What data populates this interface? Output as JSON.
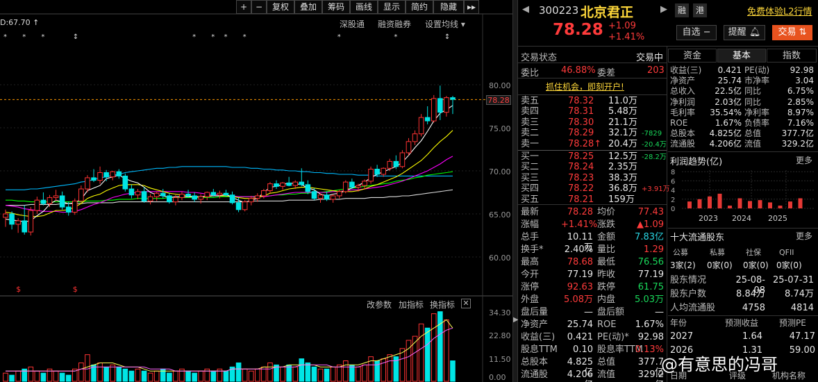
{
  "toolbar": {
    "items": [
      "+",
      "−",
      "复权",
      "叠加",
      "筹码",
      "画线",
      "显示",
      "简约",
      "隐藏"
    ],
    "ma_value": "D:67.70",
    "links": [
      "深股通",
      "融资融券",
      "设置均线"
    ]
  },
  "chart": {
    "price_axis": [
      "80.00",
      "75.00",
      "70.00",
      "65.00",
      "60.00"
    ],
    "last_price_tag": "78.28",
    "volume_axis": [
      "34.30",
      "22.80",
      "11.50",
      "0.00"
    ],
    "volume_links": [
      "改参数",
      "加指标",
      "换指标"
    ],
    "colors": {
      "up": "#ff3333",
      "down": "#00e5e5",
      "ma5": "#ffffff",
      "ma10": "#ffff00",
      "ma20": "#ff00ff",
      "ma60": "#00ff00",
      "ma120": "#00bbff",
      "ma250": "#dddddd"
    }
  },
  "chart_data": {
    "type": "candlestick",
    "ylim": [
      58,
      82
    ],
    "candles": [
      [
        64.6,
        65.5,
        63.5,
        65.0
      ],
      [
        65.0,
        65.3,
        63.2,
        63.8
      ],
      [
        63.8,
        64.5,
        62.8,
        64.2
      ],
      [
        64.2,
        66.0,
        62.6,
        62.9
      ],
      [
        62.9,
        65.8,
        62.5,
        65.4
      ],
      [
        65.4,
        67.0,
        65.0,
        66.6
      ],
      [
        66.6,
        67.5,
        66.0,
        66.2
      ],
      [
        66.2,
        67.2,
        65.8,
        66.9
      ],
      [
        66.9,
        67.8,
        66.5,
        67.1
      ],
      [
        67.1,
        67.6,
        65.5,
        65.8
      ],
      [
        65.8,
        66.4,
        64.8,
        65.2
      ],
      [
        65.2,
        66.8,
        64.9,
        66.5
      ],
      [
        66.5,
        68.3,
        66.3,
        67.9
      ],
      [
        67.9,
        69.5,
        67.5,
        69.2
      ],
      [
        69.2,
        70.2,
        68.7,
        68.9
      ],
      [
        68.9,
        70.5,
        68.5,
        69.8
      ],
      [
        69.8,
        70.1,
        68.8,
        69.3
      ],
      [
        69.3,
        70.0,
        68.9,
        69.9
      ],
      [
        69.9,
        70.2,
        69.1,
        69.4
      ],
      [
        69.4,
        69.7,
        67.6,
        67.9
      ],
      [
        67.9,
        68.4,
        66.8,
        67.2
      ],
      [
        67.2,
        67.9,
        66.7,
        67.6
      ],
      [
        67.6,
        68.1,
        66.3,
        66.5
      ],
      [
        66.5,
        67.3,
        66.1,
        67.0
      ],
      [
        67.0,
        67.6,
        66.5,
        67.4
      ],
      [
        67.4,
        67.9,
        66.8,
        67.1
      ],
      [
        67.1,
        67.4,
        66.2,
        66.4
      ],
      [
        66.4,
        67.2,
        66.0,
        66.9
      ],
      [
        66.9,
        67.6,
        66.6,
        67.3
      ],
      [
        67.3,
        67.8,
        66.9,
        67.1
      ],
      [
        67.1,
        67.5,
        66.4,
        66.7
      ],
      [
        66.7,
        67.3,
        66.2,
        67.0
      ],
      [
        67.0,
        67.6,
        66.6,
        67.5
      ],
      [
        67.5,
        67.9,
        67.0,
        67.2
      ],
      [
        67.2,
        67.7,
        66.8,
        67.4
      ],
      [
        67.4,
        67.8,
        67.0,
        67.2
      ],
      [
        67.2,
        67.6,
        66.1,
        66.3
      ],
      [
        66.3,
        66.9,
        65.2,
        65.5
      ],
      [
        65.5,
        66.6,
        65.3,
        66.4
      ],
      [
        66.4,
        67.1,
        66.0,
        66.8
      ],
      [
        66.8,
        67.4,
        66.4,
        67.1
      ],
      [
        67.1,
        67.9,
        66.8,
        67.7
      ],
      [
        67.7,
        68.7,
        67.4,
        68.5
      ],
      [
        68.5,
        68.9,
        67.9,
        68.2
      ],
      [
        68.2,
        68.7,
        67.8,
        68.6
      ],
      [
        68.6,
        69.3,
        68.2,
        68.3
      ],
      [
        68.3,
        68.9,
        67.9,
        68.7
      ],
      [
        68.7,
        70.3,
        68.2,
        68.4
      ],
      [
        68.4,
        68.9,
        67.3,
        67.6
      ],
      [
        67.6,
        68.0,
        66.6,
        66.8
      ],
      [
        66.8,
        67.4,
        66.3,
        67.2
      ],
      [
        67.2,
        67.6,
        66.5,
        66.7
      ],
      [
        66.7,
        67.3,
        66.3,
        67.1
      ],
      [
        67.1,
        67.8,
        66.8,
        67.6
      ],
      [
        67.6,
        68.9,
        67.4,
        68.7
      ],
      [
        68.7,
        69.1,
        67.9,
        68.1
      ],
      [
        68.1,
        68.5,
        67.6,
        68.3
      ],
      [
        68.3,
        69.0,
        67.9,
        68.8
      ],
      [
        68.8,
        70.5,
        68.5,
        70.2
      ],
      [
        70.2,
        70.7,
        69.3,
        69.6
      ],
      [
        69.6,
        70.4,
        69.3,
        70.3
      ],
      [
        70.3,
        71.4,
        70.0,
        71.1
      ],
      [
        71.1,
        71.8,
        70.2,
        70.5
      ],
      [
        70.5,
        72.4,
        70.3,
        72.1
      ],
      [
        72.1,
        73.8,
        71.8,
        73.4
      ],
      [
        73.4,
        74.7,
        73.0,
        74.3
      ],
      [
        74.3,
        76.6,
        74.0,
        76.2
      ],
      [
        76.2,
        77.5,
        75.4,
        75.8
      ],
      [
        75.8,
        78.8,
        75.6,
        78.4
      ],
      [
        78.4,
        79.9,
        75.9,
        76.8
      ],
      [
        76.8,
        78.7,
        76.3,
        78.5
      ],
      [
        78.5,
        78.7,
        76.6,
        78.3
      ]
    ],
    "volume": [
      4,
      3,
      5,
      6,
      7,
      5,
      4,
      6,
      5,
      4,
      3,
      6,
      9,
      13,
      8,
      9,
      7,
      8,
      7,
      6,
      5,
      6,
      5,
      4,
      5,
      6,
      4,
      5,
      6,
      5,
      4,
      5,
      6,
      5,
      6,
      5,
      7,
      9,
      6,
      5,
      6,
      7,
      9,
      8,
      7,
      8,
      7,
      11,
      9,
      7,
      6,
      6,
      7,
      8,
      10,
      8,
      7,
      8,
      12,
      10,
      11,
      13,
      12,
      16,
      20,
      22,
      28,
      26,
      33,
      34,
      30,
      10
    ],
    "ma5": [
      64.4,
      64.3,
      64.2,
      64.1,
      64.2,
      64.8,
      65.3,
      66.1,
      66.6,
      66.4,
      66.2,
      66.3,
      66.7,
      67.7,
      68.0,
      68.3,
      69.1,
      69.3,
      69.5,
      69.1,
      68.8,
      68.6,
      68.1,
      67.5,
      67.2,
      67.1,
      66.9,
      67.0,
      67.0,
      67.0,
      67.0,
      67.0,
      67.1,
      67.1,
      67.1,
      67.3,
      66.9,
      66.6,
      66.3,
      66.6,
      66.8,
      67.5,
      68.1,
      68.2,
      68.4,
      68.6,
      68.5,
      68.4,
      68.0,
      67.8,
      67.3,
      67.1,
      67.3,
      67.4,
      67.7,
      68.0,
      68.3,
      68.7,
      69.2,
      69.6,
      69.9,
      70.2,
      70.5,
      71.0,
      71.8,
      72.7,
      73.5,
      74.6,
      75.8,
      76.7,
      77.1,
      77.6
    ],
    "ma10": [
      65.2,
      65.1,
      64.9,
      64.8,
      64.7,
      64.7,
      64.8,
      65.1,
      65.4,
      65.4,
      65.5,
      65.8,
      66.2,
      66.8,
      67.1,
      67.3,
      67.7,
      68.0,
      68.3,
      68.4,
      68.4,
      68.4,
      68.3,
      68.0,
      67.8,
      67.6,
      67.4,
      67.3,
      67.2,
      67.1,
      67.0,
      67.0,
      67.0,
      67.1,
      67.1,
      67.1,
      67.0,
      66.9,
      66.8,
      66.8,
      66.9,
      67.1,
      67.4,
      67.5,
      67.7,
      67.9,
      68.0,
      68.1,
      68.1,
      68.0,
      67.9,
      67.8,
      67.7,
      67.6,
      67.6,
      67.6,
      67.7,
      67.9,
      68.2,
      68.4,
      68.7,
      69.0,
      69.3,
      69.7,
      70.2,
      70.7,
      71.2,
      71.9,
      72.7,
      73.4,
      74.0,
      74.7
    ],
    "ma20": [
      66.0,
      65.9,
      65.8,
      65.6,
      65.5,
      65.4,
      65.3,
      65.3,
      65.3,
      65.2,
      65.2,
      65.3,
      65.5,
      65.8,
      66.1,
      66.3,
      66.6,
      66.9,
      67.1,
      67.3,
      67.4,
      67.5,
      67.6,
      67.6,
      67.6,
      67.6,
      67.6,
      67.6,
      67.6,
      67.5,
      67.5,
      67.4,
      67.3,
      67.2,
      67.2,
      67.1,
      67.1,
      67.0,
      67.0,
      67.0,
      67.0,
      67.0,
      67.1,
      67.2,
      67.3,
      67.4,
      67.5,
      67.5,
      67.5,
      67.5,
      67.5,
      67.5,
      67.6,
      67.6,
      67.7,
      67.8,
      67.8,
      67.9,
      68.0,
      68.1,
      68.2,
      68.4,
      68.6,
      68.8,
      69.1,
      69.4,
      69.7,
      70.0,
      70.4,
      70.8,
      71.3,
      71.7
    ],
    "ma60": [
      66.6,
      66.6,
      66.5,
      66.5,
      66.4,
      66.4,
      66.4,
      66.4,
      66.4,
      66.4,
      66.4,
      66.4,
      66.4,
      66.5,
      66.5,
      66.5,
      66.6,
      66.6,
      66.7,
      66.7,
      66.7,
      66.8,
      66.8,
      66.8,
      66.8,
      66.8,
      66.9,
      66.9,
      66.9,
      66.9,
      66.9,
      66.9,
      66.9,
      66.9,
      67.0,
      67.0,
      67.0,
      67.0,
      67.0,
      67.0,
      67.1,
      67.1,
      67.1,
      67.2,
      67.2,
      67.3,
      67.3,
      67.4,
      67.4,
      67.5,
      67.5,
      67.6,
      67.7,
      67.8,
      67.9,
      68.0,
      68.1,
      68.2,
      68.3,
      68.4,
      68.5,
      68.6,
      68.8,
      68.9,
      69.0,
      69.2,
      69.3,
      69.5,
      69.6,
      69.7,
      69.8,
      69.9
    ],
    "ma120": [
      67.8,
      67.8,
      67.8,
      67.8,
      67.9,
      67.9,
      68.0,
      68.1,
      68.2,
      68.3,
      68.4,
      68.5,
      68.7,
      68.8,
      69.0,
      69.2,
      69.3,
      69.5,
      69.6,
      69.8,
      69.9,
      70.0,
      70.1,
      70.2,
      70.3,
      70.3,
      70.4,
      70.4,
      70.5,
      70.5,
      70.5,
      70.5,
      70.5,
      70.5,
      70.5,
      70.5,
      70.4,
      70.4,
      70.4,
      70.3,
      70.3,
      70.2,
      70.2,
      70.1,
      70.1,
      70.0,
      70.0,
      69.9,
      69.9,
      69.8,
      69.8,
      69.7,
      69.7,
      69.6,
      69.6,
      69.6,
      69.5,
      69.5,
      69.5,
      69.4,
      69.4,
      69.4,
      69.4,
      69.4,
      69.4,
      69.4,
      69.4,
      69.4,
      69.4,
      69.4,
      69.4,
      69.4
    ],
    "ma250": [
      66.0,
      66.0,
      66.0,
      66.0,
      66.1,
      66.1,
      66.1,
      66.1,
      66.1,
      66.2,
      66.2,
      66.2,
      66.2,
      66.3,
      66.3,
      66.3,
      66.3,
      66.3,
      66.4,
      66.4,
      66.4,
      66.4,
      66.4,
      66.4,
      66.4,
      66.4,
      66.4,
      66.4,
      66.4,
      66.4,
      66.4,
      66.4,
      66.4,
      66.4,
      66.4,
      66.4,
      66.4,
      66.4,
      66.4,
      66.5,
      66.5,
      66.5,
      66.5,
      66.5,
      66.5,
      66.6,
      66.6,
      66.6,
      66.6,
      66.6,
      66.7,
      66.7,
      66.7,
      66.7,
      66.8,
      66.8,
      66.8,
      66.8,
      66.9,
      66.9,
      66.9,
      67.0,
      67.0,
      67.1,
      67.1,
      67.2,
      67.3,
      67.4,
      67.5,
      67.6,
      67.7,
      67.8
    ],
    "vol_ma5": [
      5,
      5,
      5,
      5,
      5,
      5,
      5,
      5,
      5,
      5,
      5,
      5,
      6,
      7,
      8,
      9,
      9,
      9,
      8,
      7,
      7,
      7,
      6,
      5,
      5,
      5,
      5,
      5,
      5,
      5,
      5,
      5,
      5,
      5,
      5,
      5,
      6,
      6,
      6,
      6,
      6,
      7,
      7,
      7,
      7,
      8,
      8,
      8,
      8,
      8,
      7,
      7,
      7,
      7,
      8,
      8,
      8,
      9,
      10,
      10,
      11,
      12,
      13,
      14,
      16,
      19,
      22,
      24,
      26,
      28,
      30,
      26
    ],
    "vol_ma10": [
      5,
      5,
      5,
      5,
      5,
      5,
      5,
      5,
      5,
      5,
      5,
      5,
      6,
      6,
      7,
      7,
      7,
      7,
      7,
      7,
      7,
      7,
      7,
      6,
      6,
      6,
      6,
      5,
      5,
      5,
      5,
      5,
      5,
      5,
      5,
      5,
      6,
      6,
      6,
      6,
      6,
      6,
      6,
      7,
      7,
      7,
      7,
      8,
      8,
      8,
      8,
      8,
      7,
      7,
      7,
      7,
      7,
      8,
      8,
      8,
      9,
      10,
      10,
      11,
      12,
      14,
      16,
      18,
      21,
      23,
      25,
      26
    ]
  },
  "header": {
    "code": "300223",
    "name": "北京君正",
    "tags": [
      "融",
      "港"
    ],
    "promo": "免费体验L2行情",
    "price": "78.28",
    "change": "+1.09",
    "change_pct": "+1.41%",
    "buttons": [
      "自选 −",
      "提醒",
      "交易"
    ]
  },
  "status": {
    "label": "交易状态",
    "value": "交易中"
  },
  "weibi": {
    "label1": "委比",
    "val1": "46.88%",
    "label2": "委差",
    "val2": "203"
  },
  "banner": "抓住机会，即刻开户!",
  "orderbook": {
    "asks": [
      {
        "label": "卖五",
        "price": "78.32",
        "vol": "11.0万",
        "chg": ""
      },
      {
        "label": "卖四",
        "price": "78.31",
        "vol": "5.48万",
        "chg": ""
      },
      {
        "label": "卖三",
        "price": "78.30",
        "vol": "21.1万",
        "chg": ""
      },
      {
        "label": "卖二",
        "price": "78.29",
        "vol": "32.1万",
        "chg": "-7829"
      },
      {
        "label": "卖一",
        "price": "78.28↑",
        "vol": "20.4万",
        "chg": "-20.4万"
      }
    ],
    "bids": [
      {
        "label": "买一",
        "price": "78.25",
        "vol": "12.5万",
        "chg": "-28.2万"
      },
      {
        "label": "买二",
        "price": "78.24",
        "vol": "2.35万",
        "chg": ""
      },
      {
        "label": "买三",
        "price": "78.23",
        "vol": "38.3万",
        "chg": ""
      },
      {
        "label": "买四",
        "price": "78.22",
        "vol": "36.8万",
        "chg": "+3.91万"
      },
      {
        "label": "买五",
        "price": "78.21",
        "vol": "159万",
        "chg": ""
      }
    ]
  },
  "quote": [
    {
      "l1": "最新",
      "v1": "78.28",
      "l2": "均价",
      "v2": "77.43"
    },
    {
      "l1": "涨幅",
      "v1": "+1.41%",
      "l2": "涨跌",
      "v2": "▲1.09"
    },
    {
      "l1": "总手",
      "v1": "10.11万",
      "l2": "金额",
      "v2": "7.83亿"
    },
    {
      "l1": "换手*",
      "v1": "2.40%",
      "l2": "量比",
      "v2": "1.29"
    },
    {
      "l1": "最高",
      "v1": "78.68",
      "l2": "最低",
      "v2": "76.56"
    },
    {
      "l1": "今开",
      "v1": "77.19",
      "l2": "昨收",
      "v2": "77.19"
    },
    {
      "l1": "涨停",
      "v1": "92.63",
      "l2": "跌停",
      "v2": "61.75"
    },
    {
      "l1": "外盘",
      "v1": "5.08万",
      "l2": "内盘",
      "v2": "5.03万"
    },
    {
      "l1": "盘后量",
      "v1": "—",
      "l2": "盘后额",
      "v2": "—"
    },
    {
      "l1": "净资产",
      "v1": "25.74",
      "l2": "ROE",
      "v2": "1.67%"
    },
    {
      "l1": "收益(三)",
      "v1": "0.421",
      "l2": "PE(动)*",
      "v2": "92.98"
    },
    {
      "l1": "股息TTM",
      "v1": "0.10",
      "l2": "股息率TTM",
      "v2": "0.13%"
    },
    {
      "l1": "总股本",
      "v1": "4.825亿",
      "l2": "总值",
      "v2": "377.7亿"
    },
    {
      "l1": "流通股",
      "v1": "4.206亿",
      "l2": "流值",
      "v2": "329.2亿"
    }
  ],
  "tabs": [
    "资金",
    "基本",
    "指数"
  ],
  "fundamentals": [
    {
      "l1": "收益(三)",
      "v1": "0.421",
      "l2": "PE(动)",
      "v2": "92.98"
    },
    {
      "l1": "净资产",
      "v1": "25.74",
      "l2": "市净率",
      "v2": "3.04"
    },
    {
      "l1": "总收入",
      "v1": "22.5亿",
      "l2": "同比",
      "v2": "6.75%"
    },
    {
      "l1": "净利润",
      "v1": "2.03亿",
      "l2": "同比",
      "v2": "2.85%"
    },
    {
      "l1": "毛利率",
      "v1": "35.54%",
      "l2": "净利率",
      "v2": "8.97%"
    },
    {
      "l1": "ROE",
      "v1": "1.67%",
      "l2": "负债率",
      "v2": "7.16%"
    },
    {
      "l1": "总股本",
      "v1": "4.825亿",
      "l2": "总值",
      "v2": "377.7亿"
    },
    {
      "l1": "流通股",
      "v1": "4.206亿",
      "l2": "流值",
      "v2": "329.2亿"
    }
  ],
  "profit": {
    "title": "利润趋势(亿)",
    "more": "更多",
    "yaxis": [
      "8",
      "6",
      "4",
      "2",
      "0"
    ],
    "xaxis": [
      "2023",
      "2024",
      "2025"
    ],
    "bars": [
      1.5,
      2.0,
      2.6,
      3.2,
      0.6,
      2.2,
      1.6,
      1.8,
      1.3,
      0.6,
      1.5,
      2.2
    ]
  },
  "holders": {
    "title": "十大流通股东",
    "more": "更多",
    "headers": [
      "公募",
      "私募",
      "社保",
      "QFII"
    ],
    "values": [
      "3家(2)",
      "0家(0)",
      "0家(0)",
      "0家(0)"
    ],
    "rows": [
      {
        "label": "股东情况",
        "v1": "25-08-08",
        "v2": "25-07-31"
      },
      {
        "label": "股东户数",
        "v1": "8.84万",
        "v2": "8.74万"
      },
      {
        "label": "人均流通股",
        "v1": "4758",
        "v2": "4814"
      }
    ]
  },
  "forecast": {
    "headers": [
      "年份",
      "预测收益",
      "预测PE"
    ],
    "rows": [
      {
        "year": "2027",
        "eps": "1.64",
        "pe": "47.17"
      },
      {
        "year": "2026",
        "eps": "1.31",
        "pe": "59.00"
      }
    ],
    "footer": [
      "日期",
      "评级",
      "机构名称"
    ]
  },
  "watermark": "@有意思的冯哥"
}
